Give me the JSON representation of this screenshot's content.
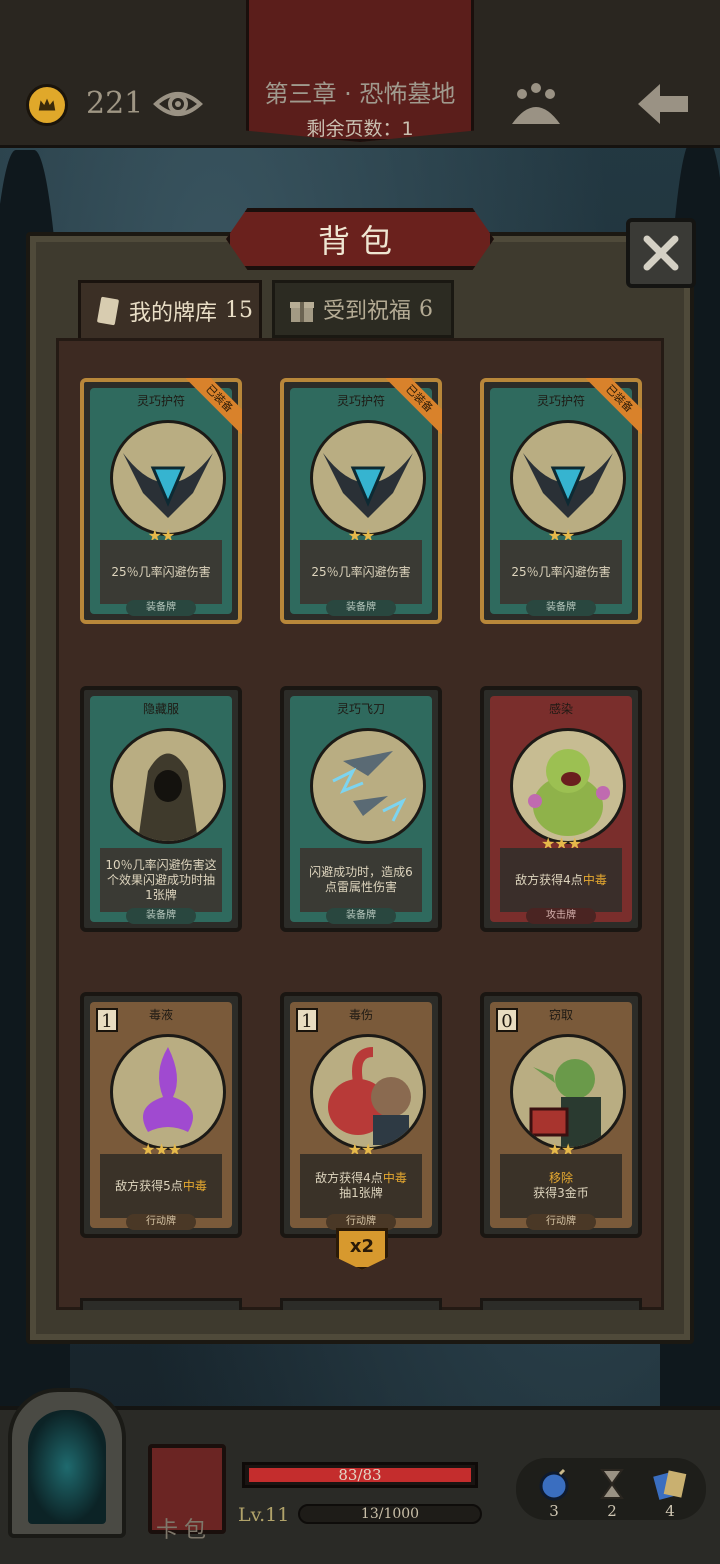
{
  "header": {
    "gold": "221",
    "chapter_title": "第三章 · 恐怖墓地",
    "pages_left": "剩余页数：1"
  },
  "panel": {
    "title": "背包",
    "tabs": [
      {
        "label": "我的牌库",
        "count": "15",
        "active": true
      },
      {
        "label": "受到祝福",
        "count": "6",
        "active": false
      }
    ]
  },
  "cards": [
    {
      "name": "灵巧护符",
      "desc": "25％几率闪避伤害",
      "type": "装备牌",
      "stars": "★★",
      "badge": "已装备",
      "color": "green"
    },
    {
      "name": "灵巧护符",
      "desc": "25％几率闪避伤害",
      "type": "装备牌",
      "stars": "★★",
      "badge": "已装备",
      "color": "green"
    },
    {
      "name": "灵巧护符",
      "desc": "25％几率闪避伤害",
      "type": "装备牌",
      "stars": "★★",
      "badge": "已装备",
      "color": "green"
    },
    {
      "name": "隐藏服",
      "desc": "10％几率闪避伤害这个效果闪避成功时抽1张牌",
      "type": "装备牌",
      "stars": "",
      "color": "green"
    },
    {
      "name": "灵巧飞刀",
      "desc": "闪避成功时，造成6点雷属性伤害",
      "type": "装备牌",
      "stars": "",
      "color": "green"
    },
    {
      "name": "感染",
      "desc_pre": "敌方获得4点",
      "desc_hl": "中毒",
      "type": "攻击牌",
      "stars": "★★★",
      "color": "red"
    },
    {
      "name": "毒液",
      "cost": "1",
      "desc_pre": "敌方获得5点",
      "desc_hl": "中毒",
      "type": "行动牌",
      "stars": "★★★",
      "color": "brown"
    },
    {
      "name": "毒伤",
      "cost": "1",
      "desc_pre": "敌方获得4点",
      "desc_hl": "中毒",
      "desc_post": "抽1张牌",
      "type": "行动牌",
      "stars": "★★",
      "color": "brown",
      "multiplier": "x2"
    },
    {
      "name": "窃取",
      "cost": "0",
      "desc_hl": "移除",
      "desc_post": "获得3金币",
      "type": "行动牌",
      "stars": "★★",
      "color": "brown"
    }
  ],
  "bottom": {
    "deck_label": "卡包",
    "hp": "83/83",
    "hp_fraction": 1.0,
    "level": "Lv.11",
    "xp": "13/1000",
    "items": [
      {
        "icon": "bomb-icon",
        "count": "3"
      },
      {
        "icon": "hourglass-icon",
        "count": "2"
      },
      {
        "icon": "cards-icon",
        "count": "4"
      }
    ]
  },
  "colors": {
    "equipped_ribbon": "#d9822b",
    "poison_highlight": "#e6a930",
    "hp_fill": "#c42d2d"
  }
}
